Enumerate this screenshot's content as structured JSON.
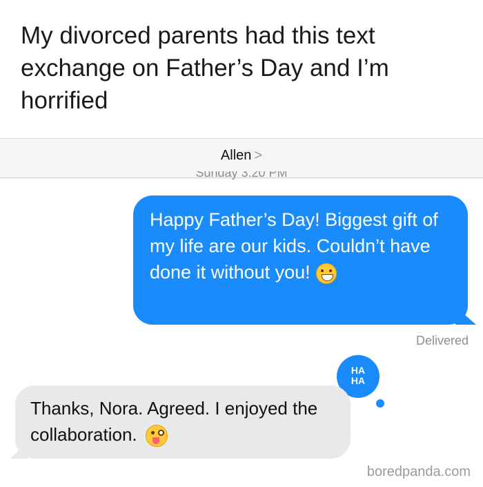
{
  "headline": "My divorced parents had this text exchange on  Father’s Day and I’m horrified",
  "conversation": {
    "contact_name": "Allen",
    "contact_chevron": ">",
    "timestamp": "Sunday 3:20 PM"
  },
  "messages": {
    "outgoing_text": "Happy Father’s Day! Biggest gift of my life are our kids. Couldn’t have done it without you!",
    "outgoing_emoji": "grinning-face",
    "outgoing_status": "Delivered",
    "incoming_text": "Thanks, Nora. Agreed. I enjoyed the collaboration.",
    "incoming_emoji": "winking-face-with-tongue",
    "reaction_top": "HA",
    "reaction_bottom": "HA"
  },
  "watermark": "boredpanda.com",
  "colors": {
    "outgoing_bubble": "#1a8bfb",
    "incoming_bubble": "#e9e9eb"
  }
}
